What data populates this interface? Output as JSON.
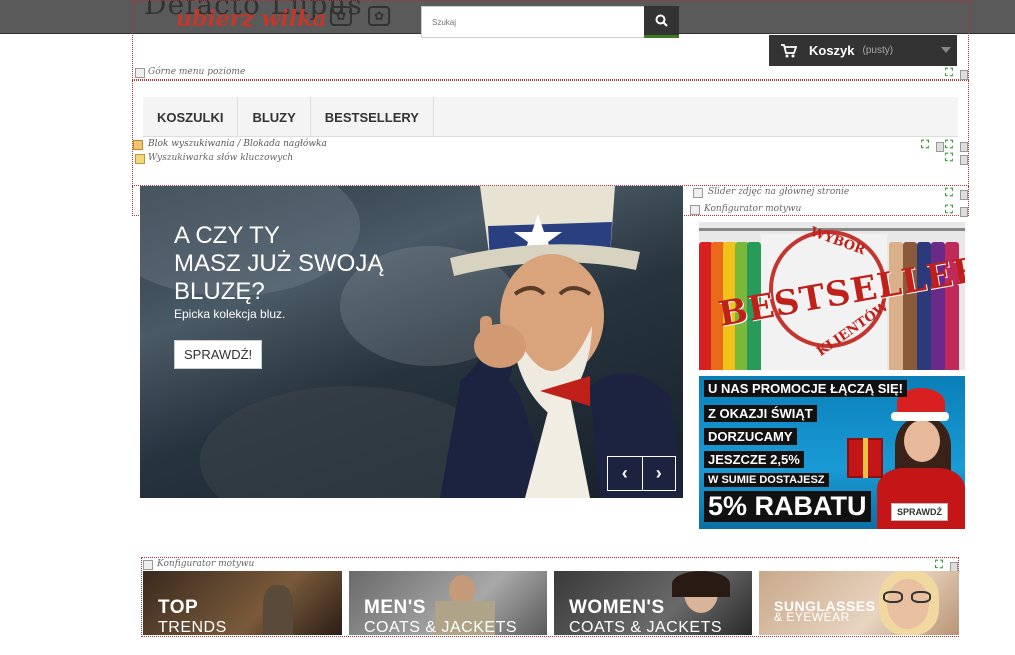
{
  "logo": {
    "line1": "Defacto Lupus",
    "line2": "ubierz wilka"
  },
  "search": {
    "placeholder": "Szukaj"
  },
  "cart": {
    "title": "Koszyk",
    "status": "(pusty)"
  },
  "modules": {
    "top_menu": "Górne menu poziome",
    "block_overlay": "Blok wyszukiwania / Blokada nagłówka",
    "keyword_search": "Wyszukiwarka słów kluczowych",
    "home_slider": "Slider zdjęć na głównej stronie",
    "theme_config_1": "Konfigurator motywu",
    "theme_config_2": "Konfigurator motywu"
  },
  "menu": {
    "items": [
      "KOSZULKI",
      "BLUZY",
      "BESTSELLERY"
    ]
  },
  "slider": {
    "heading": "A CZY TY\nMASZ JUŻ SWOJĄ\nBLUZĘ?",
    "subheading": "Epicka kolekcja bluz.",
    "button": "SPRAWDŹ!",
    "prev": "‹",
    "next": "›"
  },
  "banner_bestseller": {
    "stamp": "BESTSELLER",
    "top": "WYBÓR",
    "bottom": "KLIENTÓW"
  },
  "banner_promo": {
    "lines": [
      "U NAS PROMOCJE ŁĄCZĄ SIĘ!",
      "Z OKAZJI ŚWIĄT",
      "DORZUCAMY",
      "JESZCZE 2,5%",
      "W SUMIE DOSTAJESZ",
      "5% RABATU"
    ],
    "button": "SPRAWDŹ"
  },
  "categories": [
    {
      "title": "TOP",
      "sub": "TRENDS"
    },
    {
      "title": "MEN'S",
      "sub": "COATS & JACKETS"
    },
    {
      "title": "WOMEN'S",
      "sub": "COATS & JACKETS"
    },
    {
      "title": "SUNGLASSES",
      "sub": "& EYEWEAR"
    }
  ],
  "colors": {
    "accent_green": "#3a7d22",
    "dark": "#333333",
    "brand_red": "#c0392b"
  }
}
